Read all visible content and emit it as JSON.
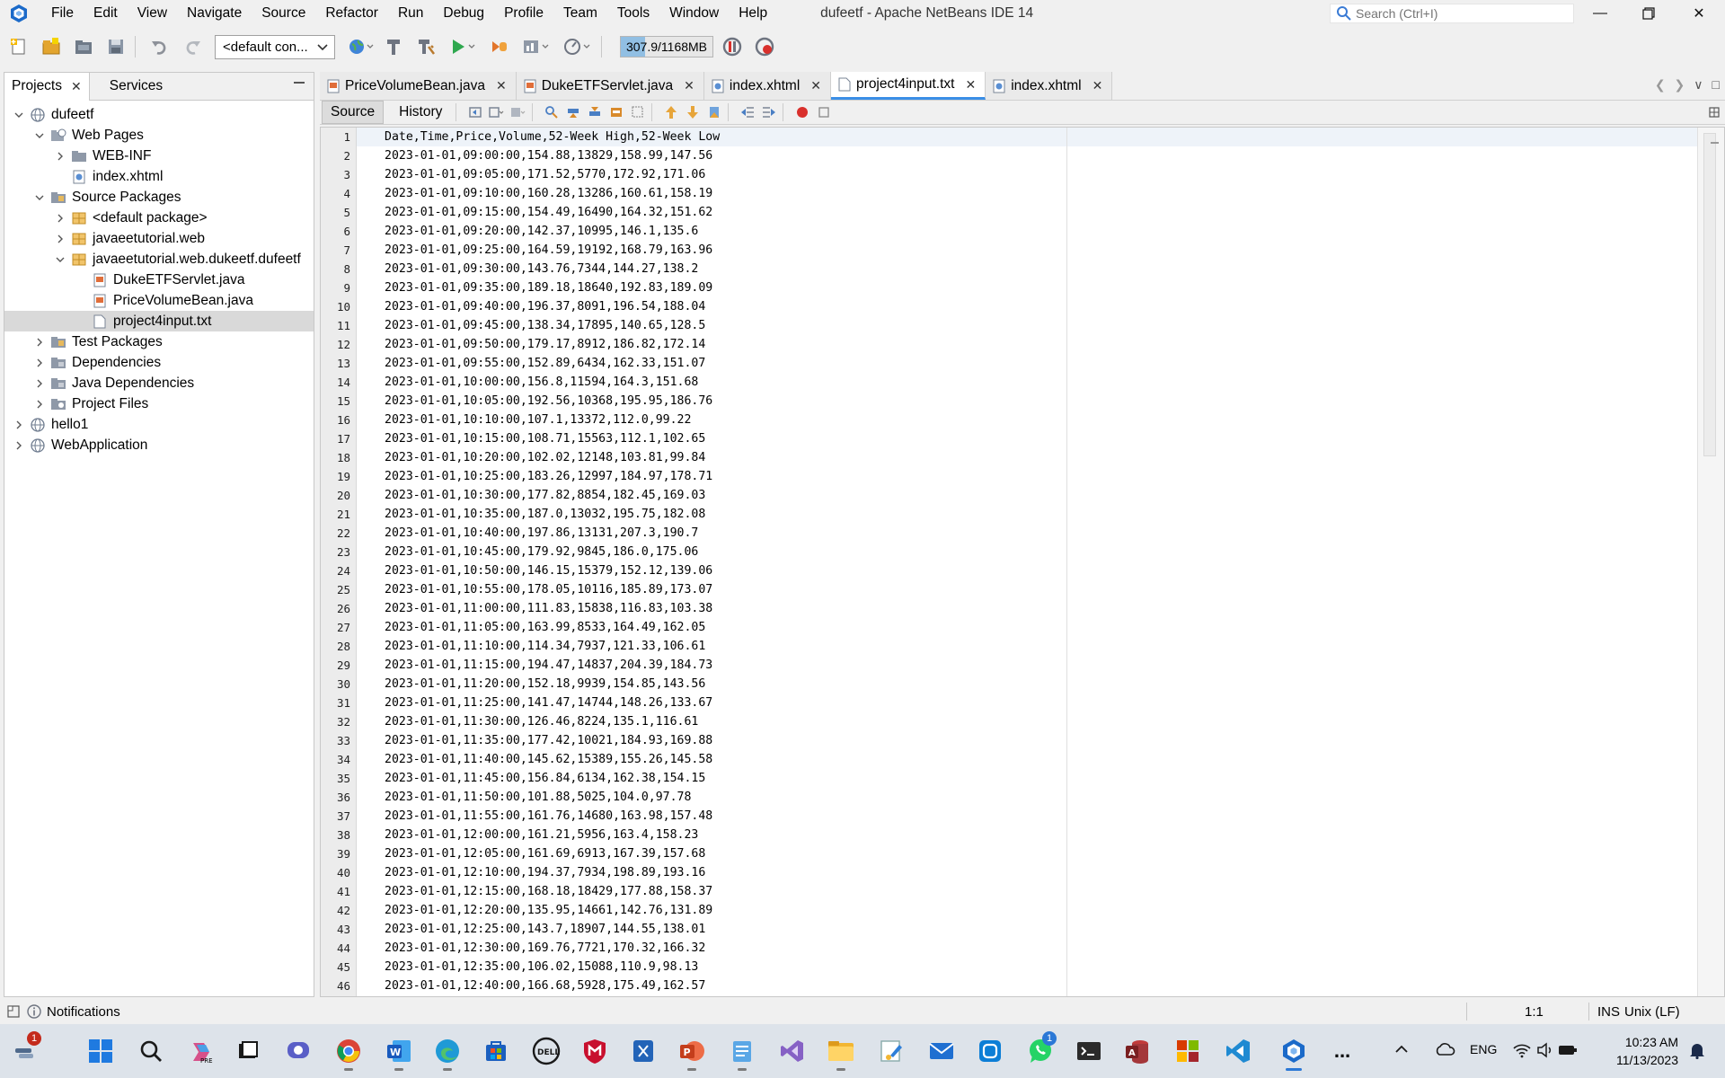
{
  "titlebar": {
    "menu": [
      "File",
      "Edit",
      "View",
      "Navigate",
      "Source",
      "Refactor",
      "Run",
      "Debug",
      "Profile",
      "Team",
      "Tools",
      "Window",
      "Help"
    ],
    "window_title": "dufeetf - Apache NetBeans IDE 14",
    "search_placeholder": "Search (Ctrl+I)"
  },
  "toolbar": {
    "config": "<default con...",
    "memory": "307.9/1168MB",
    "memory_fraction": 0.264
  },
  "projects_panel": {
    "tabs": [
      "Projects",
      "Services"
    ],
    "tree": [
      {
        "label": "dufeetf",
        "depth": 0,
        "expanded": true,
        "icon": "project-globe-icon"
      },
      {
        "label": "Web Pages",
        "depth": 1,
        "expanded": true,
        "icon": "web-folder-icon"
      },
      {
        "label": "WEB-INF",
        "depth": 2,
        "expanded": false,
        "icon": "folder-icon"
      },
      {
        "label": "index.xhtml",
        "depth": 2,
        "leaf": true,
        "icon": "xhtml-file-icon"
      },
      {
        "label": "Source Packages",
        "depth": 1,
        "expanded": true,
        "icon": "source-folder-icon"
      },
      {
        "label": "<default package>",
        "depth": 2,
        "expanded": false,
        "icon": "package-icon"
      },
      {
        "label": "javaeetutorial.web",
        "depth": 2,
        "expanded": false,
        "icon": "package-icon"
      },
      {
        "label": "javaeetutorial.web.dukeetf.dufeetf",
        "depth": 2,
        "expanded": true,
        "icon": "package-icon"
      },
      {
        "label": "DukeETFServlet.java",
        "depth": 3,
        "leaf": true,
        "icon": "java-file-icon"
      },
      {
        "label": "PriceVolumeBean.java",
        "depth": 3,
        "leaf": true,
        "icon": "java-file-icon"
      },
      {
        "label": "project4input.txt",
        "depth": 3,
        "leaf": true,
        "icon": "text-file-icon",
        "selected": true
      },
      {
        "label": "Test Packages",
        "depth": 1,
        "expanded": false,
        "icon": "source-folder-icon"
      },
      {
        "label": "Dependencies",
        "depth": 1,
        "expanded": false,
        "icon": "library-folder-icon"
      },
      {
        "label": "Java Dependencies",
        "depth": 1,
        "expanded": false,
        "icon": "library-folder-icon"
      },
      {
        "label": "Project Files",
        "depth": 1,
        "expanded": false,
        "icon": "config-folder-icon"
      },
      {
        "label": "hello1",
        "depth": 0,
        "expanded": false,
        "icon": "project-globe-icon"
      },
      {
        "label": "WebApplication",
        "depth": 0,
        "expanded": false,
        "icon": "project-globe-icon"
      }
    ]
  },
  "editor": {
    "tabs": [
      {
        "label": "PriceVolumeBean.java",
        "active": false,
        "icon": "java-file-icon"
      },
      {
        "label": "DukeETFServlet.java",
        "active": false,
        "icon": "java-file-icon"
      },
      {
        "label": "index.xhtml",
        "active": false,
        "icon": "xhtml-file-icon"
      },
      {
        "label": "project4input.txt",
        "active": true,
        "icon": "text-file-icon"
      },
      {
        "label": "index.xhtml",
        "active": false,
        "icon": "xhtml-file-icon"
      }
    ],
    "modes": [
      "Source",
      "History"
    ],
    "lines": [
      "Date,Time,Price,Volume,52-Week High,52-Week Low",
      "2023-01-01,09:00:00,154.88,13829,158.99,147.56",
      "2023-01-01,09:05:00,171.52,5770,172.92,171.06",
      "2023-01-01,09:10:00,160.28,13286,160.61,158.19",
      "2023-01-01,09:15:00,154.49,16490,164.32,151.62",
      "2023-01-01,09:20:00,142.37,10995,146.1,135.6",
      "2023-01-01,09:25:00,164.59,19192,168.79,163.96",
      "2023-01-01,09:30:00,143.76,7344,144.27,138.2",
      "2023-01-01,09:35:00,189.18,18640,192.83,189.09",
      "2023-01-01,09:40:00,196.37,8091,196.54,188.04",
      "2023-01-01,09:45:00,138.34,17895,140.65,128.5",
      "2023-01-01,09:50:00,179.17,8912,186.82,172.14",
      "2023-01-01,09:55:00,152.89,6434,162.33,151.07",
      "2023-01-01,10:00:00,156.8,11594,164.3,151.68",
      "2023-01-01,10:05:00,192.56,10368,195.95,186.76",
      "2023-01-01,10:10:00,107.1,13372,112.0,99.22",
      "2023-01-01,10:15:00,108.71,15563,112.1,102.65",
      "2023-01-01,10:20:00,102.02,12148,103.81,99.84",
      "2023-01-01,10:25:00,183.26,12997,184.97,178.71",
      "2023-01-01,10:30:00,177.82,8854,182.45,169.03",
      "2023-01-01,10:35:00,187.0,13032,195.75,182.08",
      "2023-01-01,10:40:00,197.86,13131,207.3,190.7",
      "2023-01-01,10:45:00,179.92,9845,186.0,175.06",
      "2023-01-01,10:50:00,146.15,15379,152.12,139.06",
      "2023-01-01,10:55:00,178.05,10116,185.89,173.07",
      "2023-01-01,11:00:00,111.83,15838,116.83,103.38",
      "2023-01-01,11:05:00,163.99,8533,164.49,162.05",
      "2023-01-01,11:10:00,114.34,7937,121.33,106.61",
      "2023-01-01,11:15:00,194.47,14837,204.39,184.73",
      "2023-01-01,11:20:00,152.18,9939,154.85,143.56",
      "2023-01-01,11:25:00,141.47,14744,148.26,133.67",
      "2023-01-01,11:30:00,126.46,8224,135.1,116.61",
      "2023-01-01,11:35:00,177.42,10021,184.93,169.88",
      "2023-01-01,11:40:00,145.62,15389,155.26,145.58",
      "2023-01-01,11:45:00,156.84,6134,162.38,154.15",
      "2023-01-01,11:50:00,101.88,5025,104.0,97.78",
      "2023-01-01,11:55:00,161.76,14680,163.98,157.48",
      "2023-01-01,12:00:00,161.21,5956,163.4,158.23",
      "2023-01-01,12:05:00,161.69,6913,167.39,157.68",
      "2023-01-01,12:10:00,194.37,7934,198.89,193.16",
      "2023-01-01,12:15:00,168.18,18429,177.88,158.37",
      "2023-01-01,12:20:00,135.95,14661,142.76,131.89",
      "2023-01-01,12:25:00,143.7,18907,144.55,138.01",
      "2023-01-01,12:30:00,169.76,7721,170.32,166.32",
      "2023-01-01,12:35:00,106.02,15088,110.9,98.13",
      "2023-01-01,12:40:00,166.68,5928,175.49,162.57"
    ]
  },
  "statusbar": {
    "notifications": "Notifications",
    "position": "1:1",
    "mode": "INS",
    "eol": "Unix (LF)"
  },
  "taskbar": {
    "time": "10:23 AM",
    "date": "11/13/2023",
    "language": "ENG",
    "badge_left": "1",
    "badge_whatsapp": "1",
    "overflow": "..."
  },
  "colors": {
    "accent": "#3a8ee6",
    "breakpoint": "#d9302c",
    "netbeans_logo": "#1b6ac9"
  }
}
